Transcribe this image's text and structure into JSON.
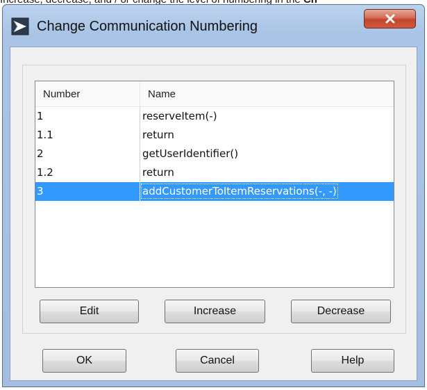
{
  "background_caption": {
    "text": "Increase, decrease, and / or change the level of numbering in the ",
    "bold_tail": "Ch"
  },
  "dialog": {
    "title": "Change Communication Numbering",
    "close_glyph": "x"
  },
  "table": {
    "columns": [
      "Number",
      "Name"
    ],
    "rows": [
      {
        "number": "1",
        "name": "reserveItem(-)",
        "selected": false
      },
      {
        "number": "1.1",
        "name": "return",
        "selected": false
      },
      {
        "number": "2",
        "name": "getUserIdentifier()",
        "selected": false
      },
      {
        "number": "1.2",
        "name": "return",
        "selected": false
      },
      {
        "number": "3",
        "name": "addCustomerToItemReservations(-, -)",
        "selected": true
      }
    ]
  },
  "numbering_buttons": {
    "edit": "Edit",
    "increase": "Increase",
    "decrease": "Decrease"
  },
  "footer_buttons": {
    "ok": "OK",
    "cancel": "Cancel",
    "help": "Help"
  },
  "colors": {
    "selection": "#3399ff",
    "close_button": "#c2442d",
    "title_bar": "#a9c4e6"
  }
}
